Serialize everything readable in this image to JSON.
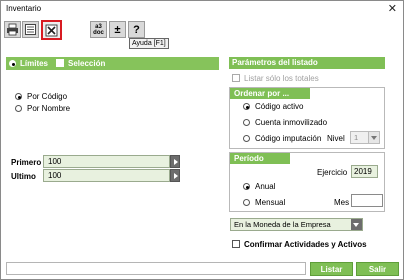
{
  "window": {
    "title": "Inventario",
    "close_glyph": "✕"
  },
  "toolbar": {
    "buttons": [
      {
        "icon": "print-icon",
        "label": ""
      },
      {
        "icon": "list-icon",
        "label": ""
      },
      {
        "icon": "excel-icon",
        "label": ""
      },
      {
        "icon": "a3doc-icon",
        "label": "a3\ndoc"
      },
      {
        "icon": "plus-minus-icon",
        "label": "±"
      },
      {
        "icon": "help-icon",
        "label": "?"
      }
    ],
    "tooltip": "Ayuda [F1]"
  },
  "left": {
    "mode": {
      "limites": "Límites",
      "seleccion": "Selección"
    },
    "order": {
      "por_codigo": "Por Código",
      "por_nombre": "Por Nombre"
    },
    "primero_label": "Primero",
    "primero_value": "100",
    "ultimo_label": "Ultimo",
    "ultimo_value": "100"
  },
  "right": {
    "params_header": "Parámetros del listado",
    "listar_totales": "Listar sólo los totales",
    "ordenar_header": "Ordenar por ...",
    "codigo_activo": "Código activo",
    "cuenta_inmovilizado": "Cuenta inmovilizado",
    "codigo_imputacion": "Código imputación",
    "nivel_label": "Nivel",
    "nivel_value": "1",
    "periodo_header": "Período",
    "ejercicio_label": "Ejercicio",
    "ejercicio_value": "2019",
    "anual": "Anual",
    "mensual": "Mensual",
    "mes_label": "Mes",
    "mes_value": "",
    "moneda": "En la Moneda de la Empresa",
    "confirmar": "Confirmar Actividades y Activos"
  },
  "footer": {
    "listar": "Listar",
    "salir": "Salir"
  },
  "colors": {
    "accent": "#7fbf55",
    "highlight": "#d81b22"
  }
}
